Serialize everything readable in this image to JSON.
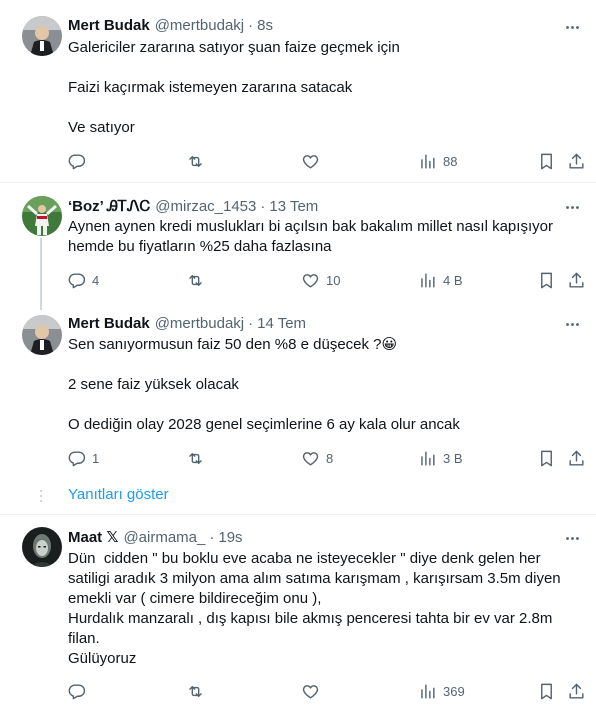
{
  "tweets": [
    {
      "name": "Mert Budak",
      "handle": "@mertbudakj",
      "time": "8s",
      "text": "Galericiler zararına satıyor şuan faize geçmek için\n\nFaizi kaçırmak istemeyen zararına satacak\n\nVe satıyor",
      "replies": "",
      "retweets": "",
      "likes": "",
      "views": "88"
    },
    {
      "name": "‘Boz’ ᎯᎢᏁᏟ",
      "handle": "@mirzac_1453",
      "time": "13 Tem",
      "text": "Aynen aynen kredi muslukları bi açılsın bak bakalım millet nasıl kapışıyor hemde bu fiyatların %25 daha fazlasına",
      "replies": "4",
      "retweets": "",
      "likes": "10",
      "views": "4 B"
    },
    {
      "name": "Mert Budak",
      "handle": "@mertbudakj",
      "time": "14 Tem",
      "text": "Sen sanıyormusun faiz 50 den %8 e düşecek ?😀\n\n2 sene faiz yüksek olacak\n\nO dediğin olay 2028 genel seçimlerine 6 ay kala olur ancak",
      "replies": "1",
      "retweets": "",
      "likes": "8",
      "views": "3 B"
    },
    {
      "name": "Maat 𝕏",
      "handle": "@airmama_",
      "time": "19s",
      "text": "Dün  cidden \" bu boklu eve acaba ne isteyecekler \" diye denk gelen her satiligi aradık 3 milyon ama alım satıma karışmam , karışırsam 3.5m diyen emekli var ( cimere bildireceğim onu ),\nHurdalık manzaralı , dış kapısı bile akmış penceresi tahta bir ev var 2.8m filan.\nGülüyoruz",
      "replies": "",
      "retweets": "",
      "likes": "",
      "views": "369"
    }
  ],
  "show_replies": "Yanıtları göster",
  "colors": {
    "text": "#0f1419",
    "secondary": "#536471",
    "link": "#1d9bf0",
    "divider": "#eff3f4",
    "thread": "#cfd9de"
  }
}
